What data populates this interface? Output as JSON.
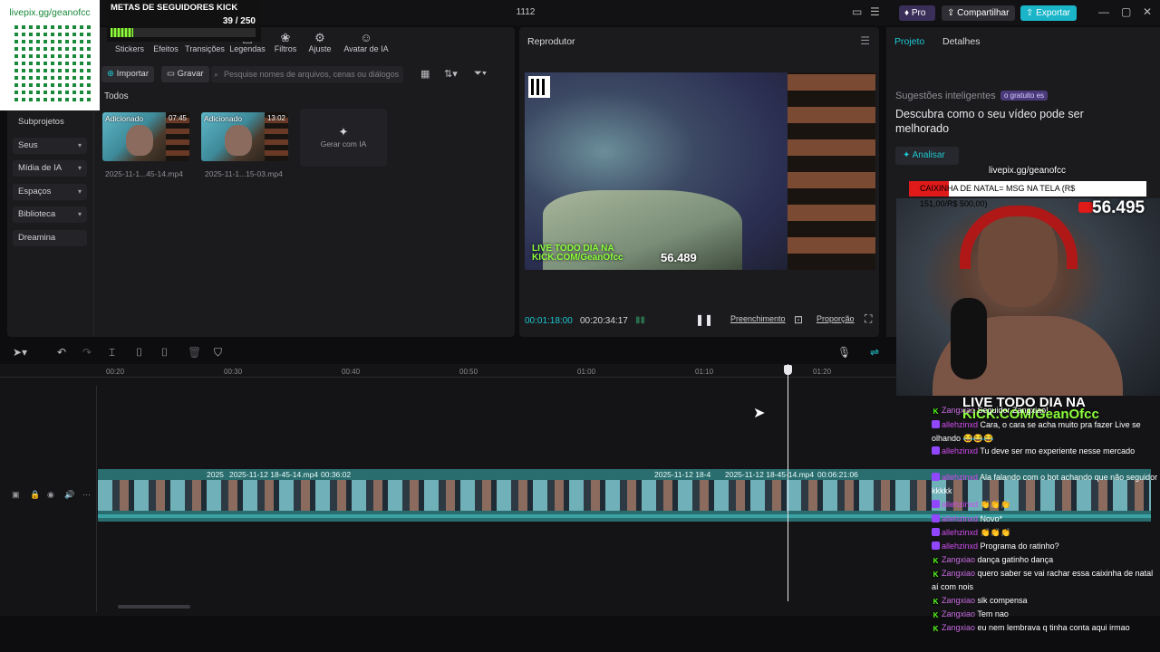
{
  "window": {
    "center_title": "1112",
    "pro_label": "Pro",
    "share_label": "Compartilhar",
    "export_label": "Exportar"
  },
  "media": {
    "tabs": [
      "Stickers",
      "Efeitos",
      "Transições",
      "Legendas",
      "Filtros",
      "Ajuste",
      "Avatar de IA"
    ],
    "import_label": "Importar",
    "record_label": "Gravar",
    "search_placeholder": "Pesquise nomes de arquivos, cenas ou diálogos",
    "section_label": "Todos",
    "sidebar": [
      {
        "label": "Subprojetos",
        "chevron": false
      },
      {
        "label": "Seus",
        "chevron": true
      },
      {
        "label": "Mídia de IA",
        "chevron": true
      },
      {
        "label": "Espaços",
        "chevron": true
      },
      {
        "label": "Biblioteca",
        "chevron": true
      },
      {
        "label": "Dreamina",
        "chevron": false
      }
    ],
    "files": [
      {
        "tag": "Adicionado",
        "duration": "07:45",
        "name": "2025-11-1...45-14.mp4"
      },
      {
        "tag": "Adicionado",
        "duration": "13:02",
        "name": "2025-11-1...15-03.mp4"
      }
    ],
    "generate_label": "Gerar com IA"
  },
  "player": {
    "title": "Reprodutor",
    "current_time": "00:01:18:00",
    "total_time": "00:20:34:17",
    "fill_label": "Preenchimento",
    "ratio_label": "Proporção",
    "overlay_text_1": "LIVE TODO DIA NA",
    "overlay_text_2": "KICK.COM/GeanOfcc",
    "overlay_count": "56.489"
  },
  "details": {
    "tab_project": "Projeto",
    "tab_details": "Detalhes",
    "suggestions_title": "Sugestões inteligentes",
    "suggestions_badge": "o gratuito es",
    "suggestions_text": "Descubra como o seu vídeo pode ser melhorado",
    "analyze_label": "Analisar"
  },
  "timeline": {
    "ruler": [
      "00:20",
      "00:30",
      "00:40",
      "00:50",
      "01:00",
      "01:10",
      "01:20"
    ],
    "clip_labels": [
      "2025",
      "2025-11-12 18-45-14.mp4",
      "00:36:02",
      "2025-11-12 18-4",
      "2025-11-12 18-45-14.mp4",
      "00:06:21:06"
    ]
  },
  "stream": {
    "qr_url": "livepix.gg/geanofcc",
    "goal_title": "METAS DE SEGUIDORES KICK",
    "goal_count": "39 / 250",
    "goal_progress": 0.156,
    "cam_url": "livepix.gg/geanofcc",
    "donation_text": "CAIXINHA DE NATAL= MSG NA TELA (R$ 151,00/R$ 500,00)",
    "cam_count": "56.495",
    "banner_1": "LIVE TODO DIA NA",
    "banner_2": "KICK.COM/GeanOfcc"
  },
  "chat": [
    {
      "platform": "k",
      "user": "Zangxiao",
      "text": "Seguidor Zangxiao!"
    },
    {
      "platform": "tw",
      "user": "allehzinxd",
      "text": "Cara, o cara se acha muito pra fazer Live se olhando 😂😂😂"
    },
    {
      "platform": "tw",
      "user": "allehzinxd",
      "text": "Tu deve ser mo experiente nesse mercado"
    },
    {
      "platform": "tw",
      "user": "allehzinxd",
      "text": "Ala falando com o bot achando que não seguidor kkkkk"
    },
    {
      "platform": "tw",
      "user": "allehzinxd",
      "text": "👏👏👏"
    },
    {
      "platform": "tw",
      "user": "allehzinxd",
      "text": "Novo*"
    },
    {
      "platform": "tw",
      "user": "allehzinxd",
      "text": "👏👏👏"
    },
    {
      "platform": "tw",
      "user": "allehzinxd",
      "text": "Programa do ratinho?"
    },
    {
      "platform": "k",
      "user": "Zangxiao",
      "text": "dança gatinho dança"
    },
    {
      "platform": "k",
      "user": "Zangxiao",
      "text": "quero saber se vai rachar essa caixinha de natal aí com nois"
    },
    {
      "platform": "k",
      "user": "Zangxiao",
      "text": "slk compensa"
    },
    {
      "platform": "k",
      "user": "Zangxiao",
      "text": "Tem nao"
    },
    {
      "platform": "k",
      "user": "Zangxiao",
      "text": "eu nem lembrava q tinha conta aqui irmao"
    }
  ],
  "colors": {
    "accent": "#1ec6cf",
    "kick_green": "#53fc18",
    "twitch_purple": "#9146ff",
    "donation_red": "#e01919"
  }
}
